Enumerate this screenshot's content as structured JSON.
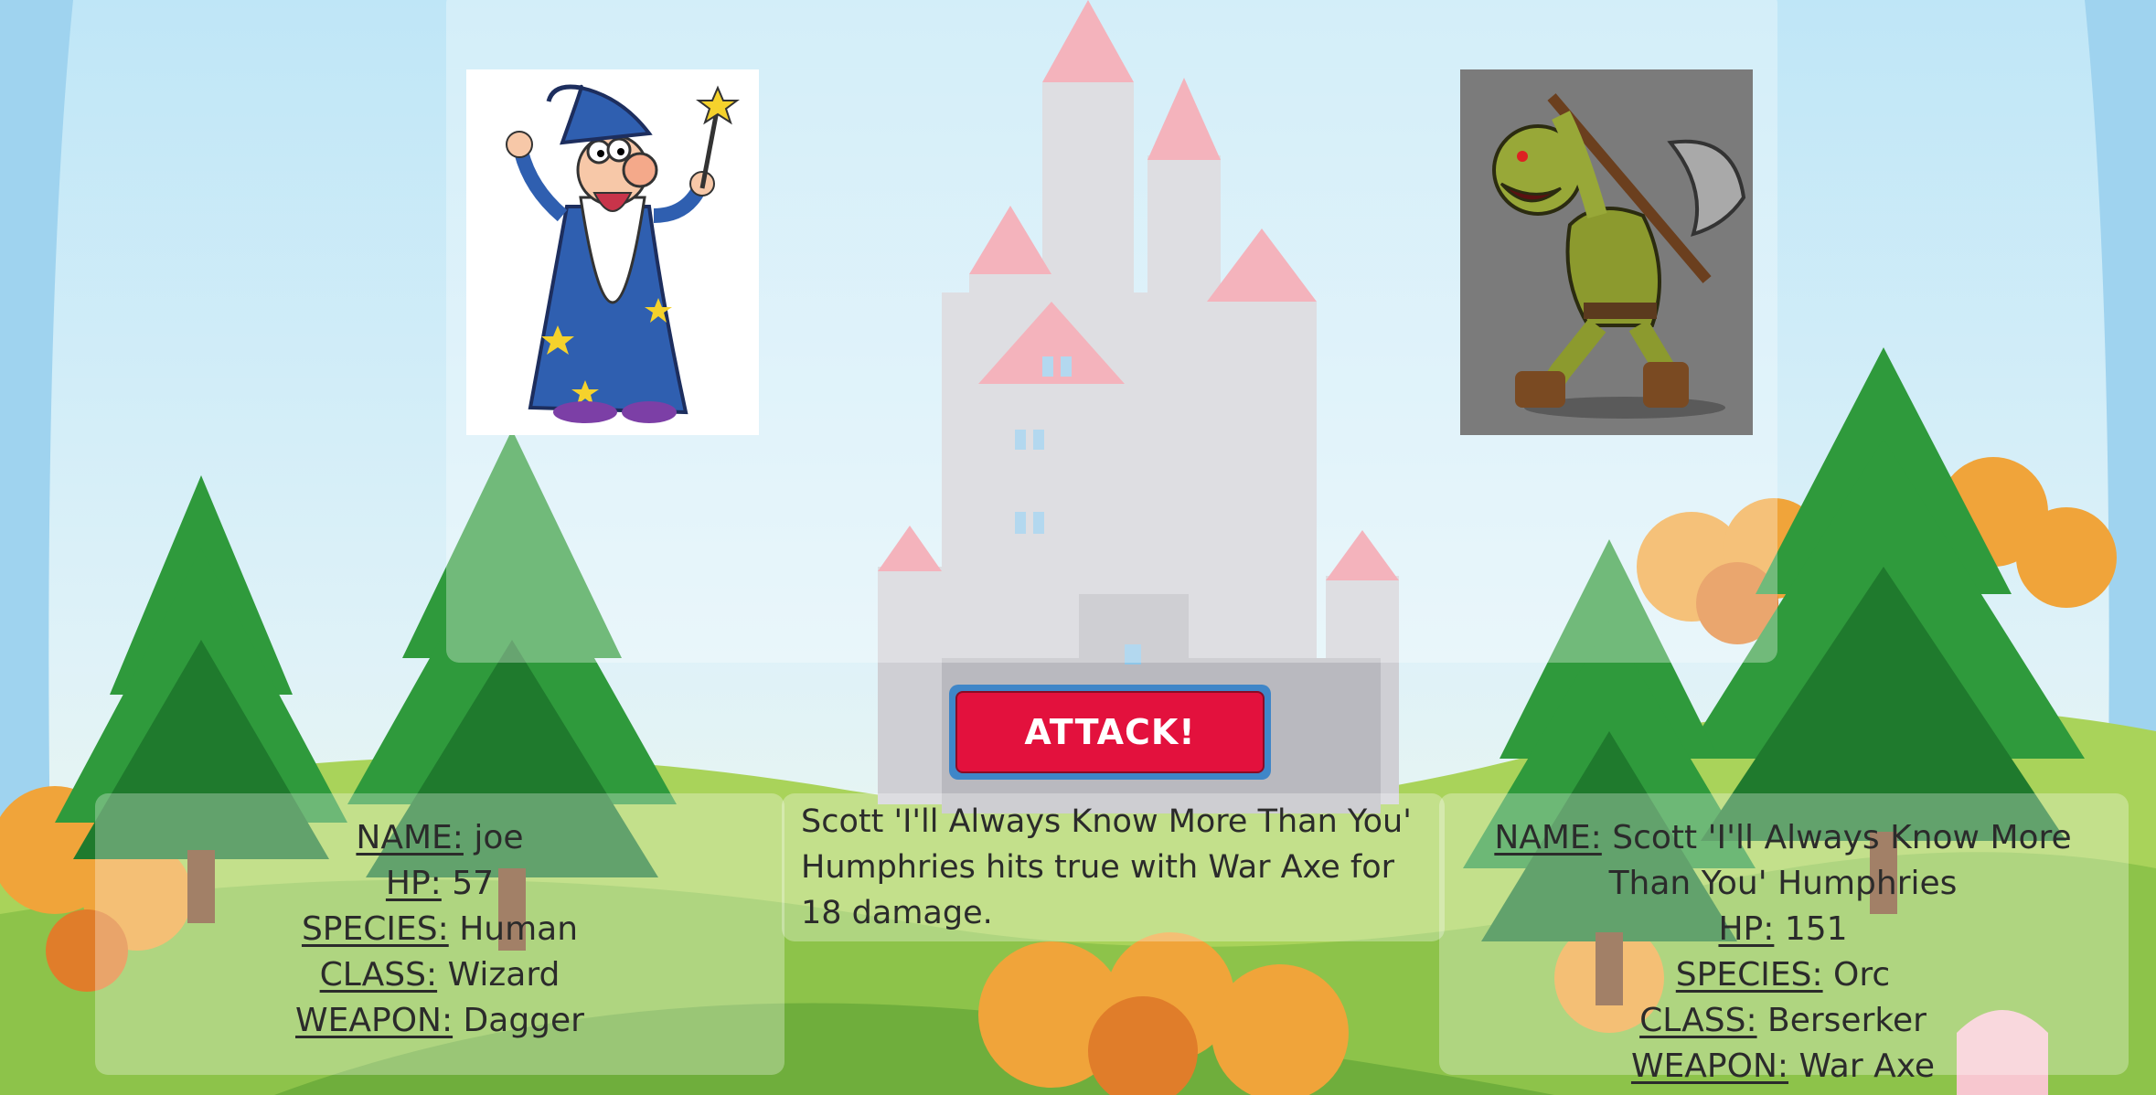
{
  "attack_button": {
    "label": "ATTACK!"
  },
  "player": {
    "portrait": "wizard-portrait",
    "labels": {
      "name": "NAME:",
      "hp": "HP:",
      "species": "SPECIES:",
      "class": "CLASS:",
      "weapon": "WEAPON:"
    },
    "name": "joe",
    "hp": "57",
    "species": "Human",
    "class": "Wizard",
    "weapon": "Dagger"
  },
  "enemy": {
    "portrait": "orc-portrait",
    "labels": {
      "name": "NAME:",
      "hp": "HP:",
      "species": "SPECIES:",
      "class": "CLASS:",
      "weapon": "WEAPON:"
    },
    "name": "Scott 'I'll Always Know More Than You' Humphries",
    "hp": "151",
    "species": "Orc",
    "class": "Berserker",
    "weapon": "War Axe"
  },
  "battle_log": {
    "message": "Scott 'I'll Always Know More Than You' Humphries hits true with War Axe for 18 damage."
  },
  "colors": {
    "attack_button": "#e3113d",
    "attack_button_outline": "#3f86c8",
    "text": "#2b2b2b"
  }
}
